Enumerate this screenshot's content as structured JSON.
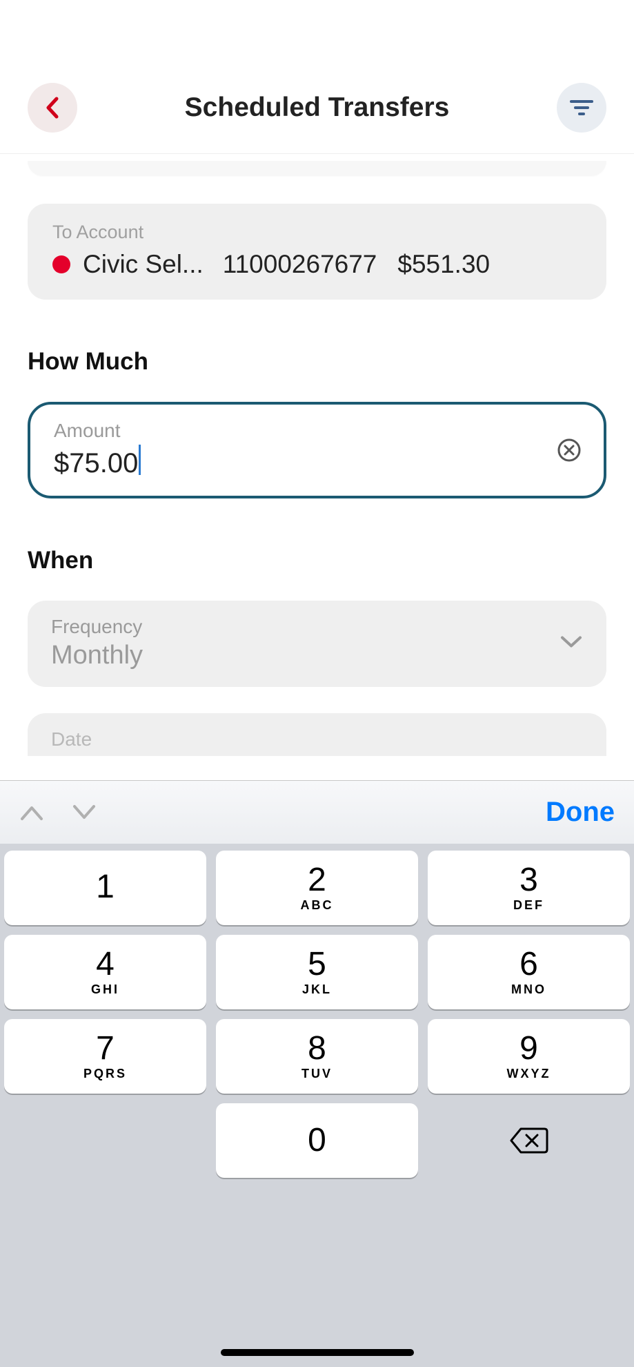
{
  "header": {
    "title": "Scheduled Transfers"
  },
  "to_account": {
    "label": "To Account",
    "name": "Civic Sel...",
    "number": "11000267677",
    "balance": "$551.30"
  },
  "how_much": {
    "title": "How Much",
    "label": "Amount",
    "value": "$75.00"
  },
  "when": {
    "title": "When",
    "freq_label": "Frequency",
    "freq_value": "Monthly",
    "date_label": "Date"
  },
  "keyboard": {
    "done": "Done",
    "keys": [
      {
        "num": "1",
        "sub": ""
      },
      {
        "num": "2",
        "sub": "ABC"
      },
      {
        "num": "3",
        "sub": "DEF"
      },
      {
        "num": "4",
        "sub": "GHI"
      },
      {
        "num": "5",
        "sub": "JKL"
      },
      {
        "num": "6",
        "sub": "MNO"
      },
      {
        "num": "7",
        "sub": "PQRS"
      },
      {
        "num": "8",
        "sub": "TUV"
      },
      {
        "num": "9",
        "sub": "WXYZ"
      },
      {
        "num": "0",
        "sub": ""
      }
    ]
  }
}
